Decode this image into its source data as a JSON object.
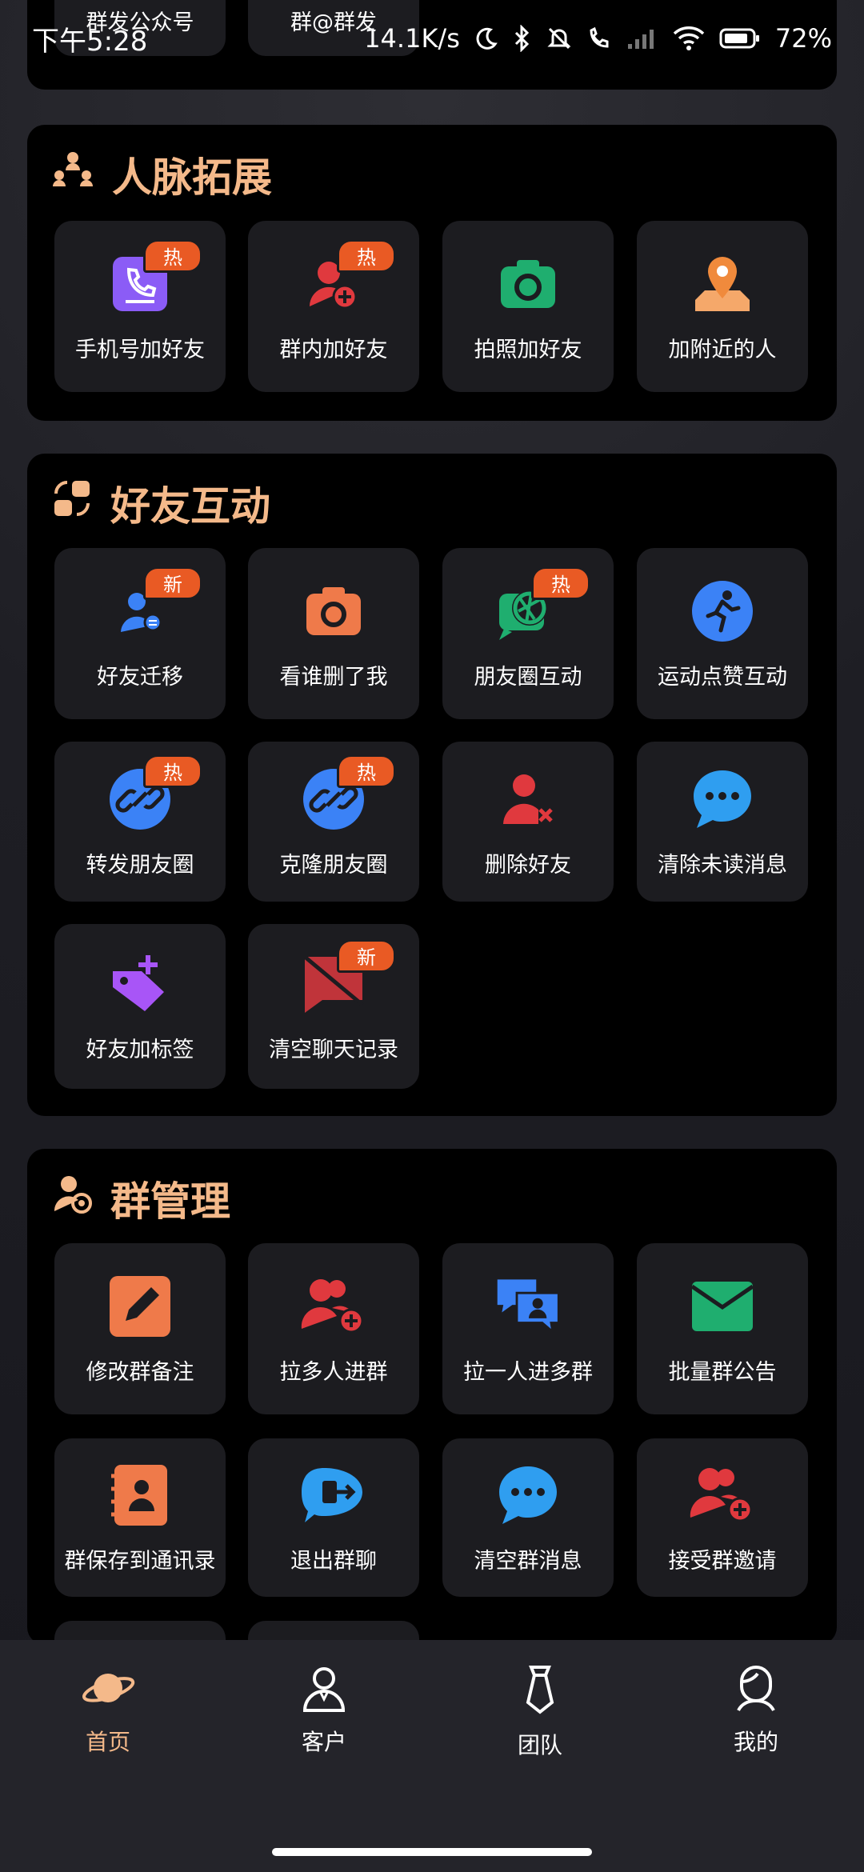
{
  "status_bar": {
    "time": "下午5:28",
    "net_speed": "14.1K/s",
    "battery": "72%"
  },
  "top_partial": {
    "tiles": [
      "群发公众号",
      "群@群发"
    ]
  },
  "sections": [
    {
      "title": "人脉拓展",
      "icon": "people-network-icon",
      "tiles": [
        {
          "label": "手机号加好友",
          "icon": "phone-icon",
          "badge": "热"
        },
        {
          "label": "群内加好友",
          "icon": "add-user-icon",
          "badge": "热"
        },
        {
          "label": "拍照加好友",
          "icon": "camera-icon",
          "badge": ""
        },
        {
          "label": "加附近的人",
          "icon": "location-pin-icon",
          "badge": ""
        }
      ]
    },
    {
      "title": "好友互动",
      "icon": "interaction-icon",
      "tiles": [
        {
          "label": "好友迁移",
          "icon": "user-transfer-icon",
          "badge": "新"
        },
        {
          "label": "看谁删了我",
          "icon": "camera-check-icon",
          "badge": ""
        },
        {
          "label": "朋友圈互动",
          "icon": "moments-icon",
          "badge": "热"
        },
        {
          "label": "运动点赞互动",
          "icon": "running-icon",
          "badge": ""
        },
        {
          "label": "转发朋友圈",
          "icon": "forward-link-icon",
          "badge": "热"
        },
        {
          "label": "克隆朋友圈",
          "icon": "clone-link-icon",
          "badge": "热"
        },
        {
          "label": "删除好友",
          "icon": "delete-user-icon",
          "badge": ""
        },
        {
          "label": "清除未读消息",
          "icon": "chat-bubble-icon",
          "badge": ""
        },
        {
          "label": "好友加标签",
          "icon": "tag-icon",
          "badge": ""
        },
        {
          "label": "清空聊天记录",
          "icon": "clear-chat-icon",
          "badge": "新"
        }
      ]
    },
    {
      "title": "群管理",
      "icon": "group-manage-icon",
      "tiles": [
        {
          "label": "修改群备注",
          "icon": "edit-icon",
          "badge": ""
        },
        {
          "label": "拉多人进群",
          "icon": "add-users-icon",
          "badge": ""
        },
        {
          "label": "拉一人进多群",
          "icon": "group-chat-icon",
          "badge": ""
        },
        {
          "label": "批量群公告",
          "icon": "mail-icon",
          "badge": ""
        },
        {
          "label": "群保存到通讯录",
          "icon": "contacts-book-icon",
          "badge": ""
        },
        {
          "label": "退出群聊",
          "icon": "exit-chat-icon",
          "badge": ""
        },
        {
          "label": "清空群消息",
          "icon": "chat-dots-icon",
          "badge": ""
        },
        {
          "label": "接受群邀请",
          "icon": "accept-invite-icon",
          "badge": ""
        }
      ]
    }
  ],
  "tabbar": [
    {
      "label": "首页",
      "icon": "planet-icon",
      "active": true
    },
    {
      "label": "客户",
      "icon": "customer-icon",
      "active": false
    },
    {
      "label": "团队",
      "icon": "tie-icon",
      "active": false
    },
    {
      "label": "我的",
      "icon": "profile-icon",
      "active": false
    }
  ],
  "colors": {
    "accent": "#f4b98a",
    "badge": "#e95a24",
    "tile_bg": "#1c1c20",
    "card_bg": "#000000"
  }
}
